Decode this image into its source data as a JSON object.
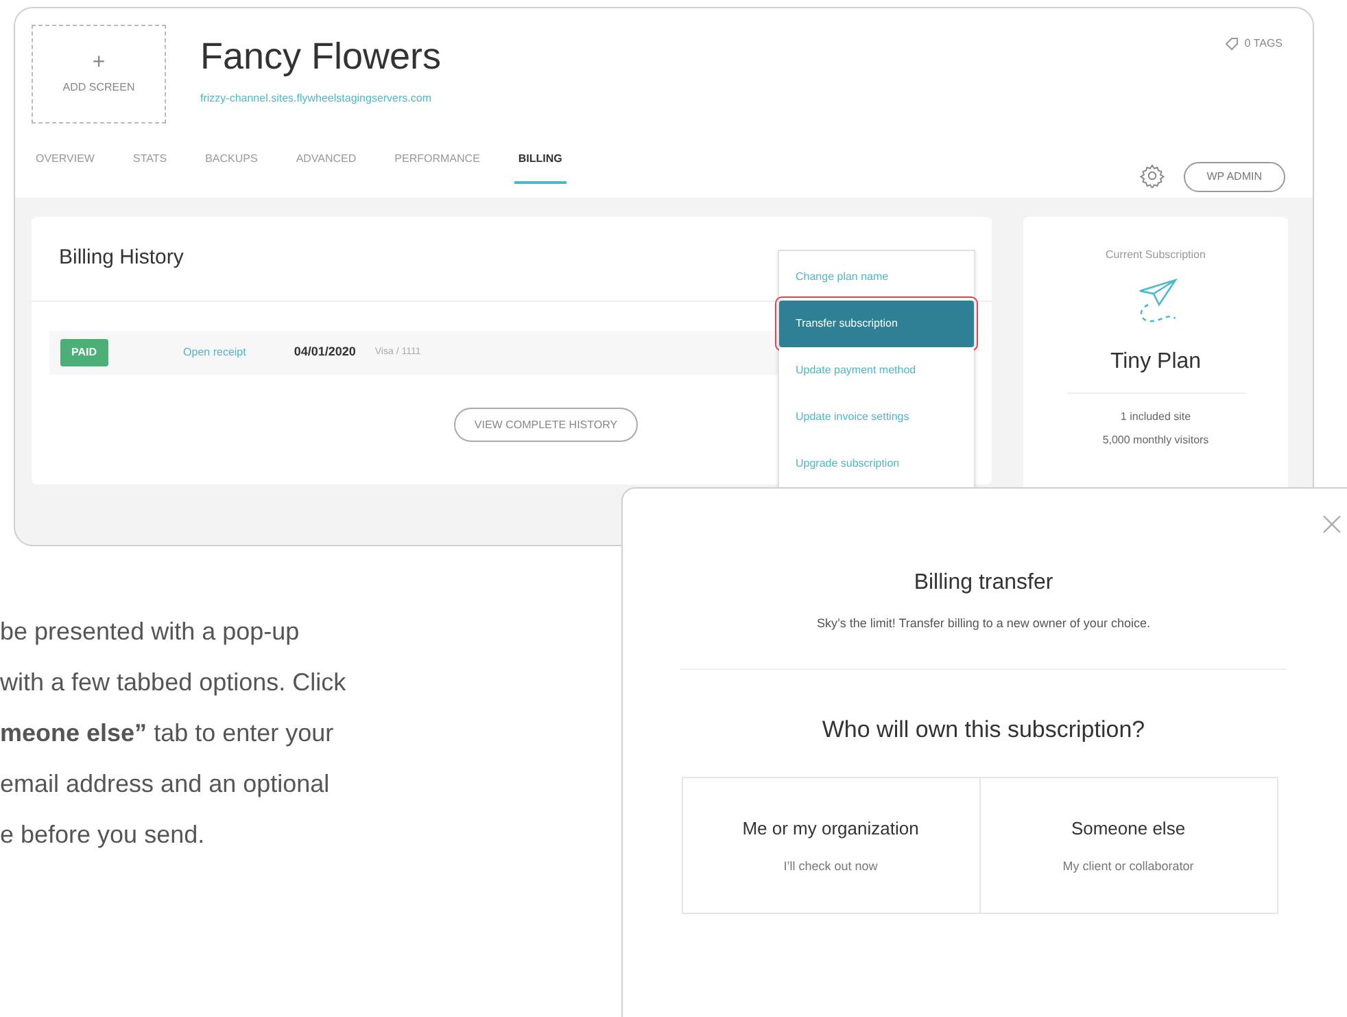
{
  "site": {
    "add_screen": {
      "icon": "+",
      "label": "ADD SCREEN"
    },
    "title": "Fancy Flowers",
    "url": "frizzy-channel.sites.flywheelstagingservers.com",
    "tags": "0 TAGS",
    "tabs": [
      {
        "label": "OVERVIEW",
        "selected": false
      },
      {
        "label": "STATS",
        "selected": false
      },
      {
        "label": "BACKUPS",
        "selected": false
      },
      {
        "label": "ADVANCED",
        "selected": false
      },
      {
        "label": "PERFORMANCE",
        "selected": false
      },
      {
        "label": "BILLING",
        "selected": true
      }
    ],
    "wp_admin": "WP ADMIN"
  },
  "billing_history": {
    "title": "Billing History",
    "rows": [
      {
        "status": "PAID",
        "receipt": "Open receipt",
        "date": "04/01/2020",
        "card": "Visa / 1111"
      }
    ],
    "button": "VIEW COMPLETE HISTORY"
  },
  "menu": {
    "items": [
      {
        "label": "Change plan name",
        "selected": false
      },
      {
        "label": "Transfer subscription",
        "selected": true
      },
      {
        "label": "Update payment method",
        "selected": false
      },
      {
        "label": "Update invoice settings",
        "selected": false
      },
      {
        "label": "Upgrade subscription",
        "selected": false
      }
    ]
  },
  "subscription": {
    "label": "Current Subscription",
    "plan": "Tiny Plan",
    "features": [
      "1 included site",
      "5,000 monthly visitors"
    ]
  },
  "instructions": {
    "lines": [
      "be presented with a pop-up",
      "with a few tabbed options. Click",
      "**meone else”** tab to enter your",
      "email address and an optional",
      "e before you send."
    ]
  },
  "dialog": {
    "title": "Billing transfer",
    "subtitle": "Sky’s the limit! Transfer billing to a new owner of your choice.",
    "question": "Who will own this subscription?",
    "options": [
      {
        "title": "Me or my organization",
        "subtitle": "I’ll check out now"
      },
      {
        "title": "Someone else",
        "subtitle": "My client or collaborator"
      }
    ]
  }
}
